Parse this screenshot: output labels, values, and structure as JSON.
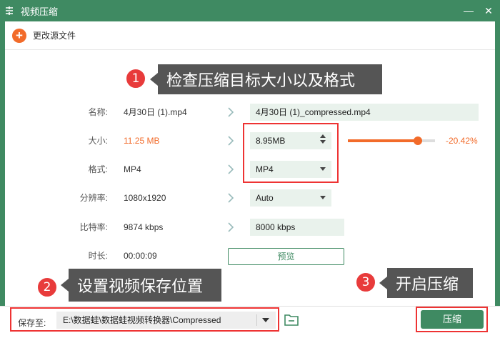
{
  "window": {
    "title": "视频压缩",
    "minimize": "—",
    "close": "✕"
  },
  "toolbar": {
    "add_source_label": "更改源文件"
  },
  "callouts": {
    "c1": {
      "number": "1",
      "text": "检查压缩目标大小以及格式"
    },
    "c2": {
      "number": "2",
      "text": "设置视频保存位置"
    },
    "c3": {
      "number": "3",
      "text": "开启压缩"
    }
  },
  "rows": {
    "name": {
      "label": "名称:",
      "source": "4月30日 (1).mp4",
      "target": "4月30日 (1)_compressed.mp4"
    },
    "size": {
      "label": "大小:",
      "source": "11.25 MB",
      "target": "8.95MB",
      "percent": "-20.42%",
      "slider_fraction": 0.8
    },
    "format": {
      "label": "格式:",
      "source": "MP4",
      "target": "MP4"
    },
    "resolution": {
      "label": "分辨率:",
      "source": "1080x1920",
      "target": "Auto"
    },
    "bitrate": {
      "label": "比特率:",
      "source": "9874 kbps",
      "target": "8000 kbps"
    },
    "duration": {
      "label": "时长:",
      "source": "00:00:09",
      "preview_label": "预览"
    }
  },
  "bottom": {
    "save_label": "保存至:",
    "save_path": "E:\\数据蛙\\数据蛙视频转换器\\Compressed",
    "compress_label": "压缩"
  },
  "colors": {
    "brand": "#3f8a62",
    "accent": "#f26b2a",
    "highlight": "#e33333"
  }
}
